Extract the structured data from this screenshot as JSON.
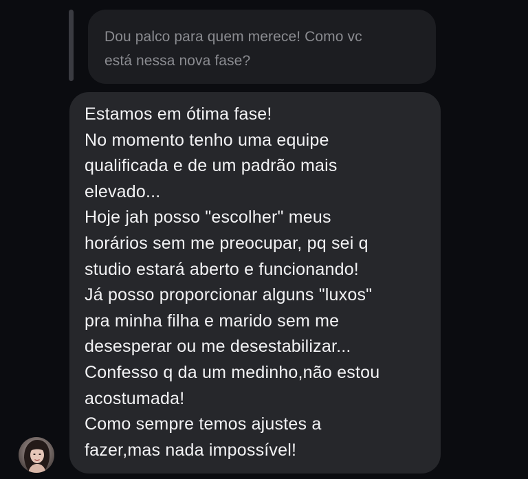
{
  "quoted_message": {
    "text": "Dou palco para quem merece! Como vc\nestá nessa nova fase?"
  },
  "message": {
    "lines": [
      "Estamos em ótima fase!",
      "No momento tenho uma equipe",
      "qualificada e de um padrão mais",
      "elevado...",
      "Hoje jah posso \"escolher\" meus",
      "horários sem me preocupar, pq sei q",
      "studio estará aberto e funcionando!",
      "Já posso proporcionar alguns \"luxos\"",
      "pra minha filha e marido sem me",
      "desesperar ou me desestabilizar...",
      "Confesso q da um medinho,não estou",
      "acostumada!",
      "Como sempre temos ajustes a",
      "fazer,mas nada impossível!"
    ]
  },
  "colors": {
    "background": "#0b0c10",
    "quoted_bubble": "#1c1d21",
    "message_bubble": "#26272b",
    "reply_bar": "#3a3b41",
    "quoted_text": "#8a8b90",
    "message_text": "#f2f2f4"
  },
  "icons": {
    "avatar": "sender-avatar"
  }
}
